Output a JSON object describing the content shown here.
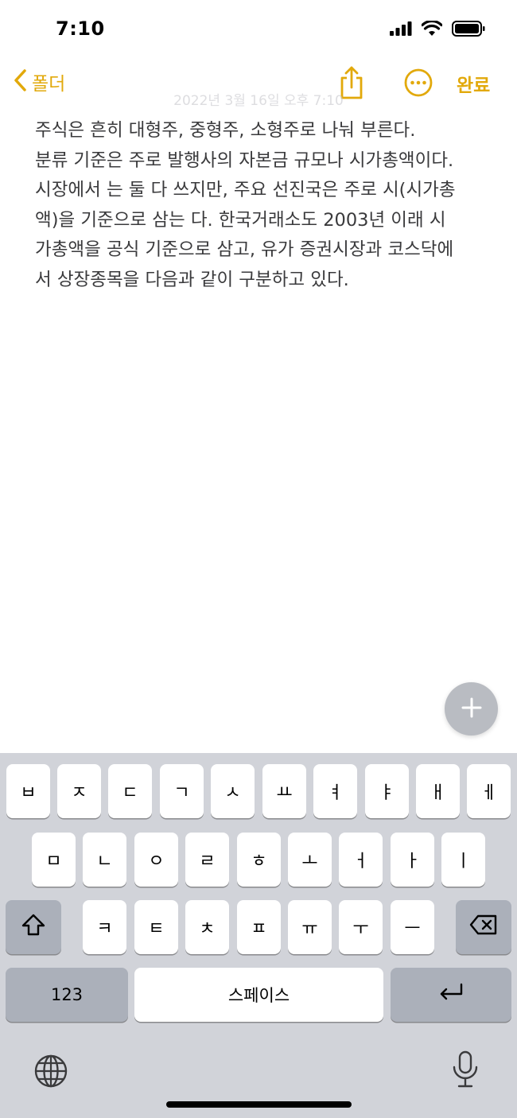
{
  "status_bar": {
    "time": "7:10",
    "icons": [
      "signal-icon",
      "wifi-icon",
      "battery-icon"
    ]
  },
  "nav": {
    "back_label": "폴더",
    "done_label": "완료",
    "share_icon": "share-icon",
    "more_icon": "ellipsis-circle-icon",
    "date_text": "2022년 3월 16일 오후 7:10"
  },
  "note": {
    "lines": [
      "주식은 흔히 대형주, 중형주, 소형주로 나눠 부른다.",
      "분류 기준은 주로 발행사의 자본금 규모나 시가총액이다.",
      "시장에서 는 둘 다 쓰지만, 주요 선진국은 주로 시(시가총",
      "액)을 기준으로 삼는 다. 한국거래소도 2003년 이래 시",
      "가총액을 공식 기준으로 삼고, 유가 증권시장과 코스닥에",
      "서 상장종목을 다음과 같이 구분하고 있다."
    ]
  },
  "fab": {
    "icon": "plus-icon"
  },
  "keyboard": {
    "row1": [
      "ㅂ",
      "ㅈ",
      "ㄷ",
      "ㄱ",
      "ㅅ",
      "ㅛ",
      "ㅕ",
      "ㅑ",
      "ㅐ",
      "ㅔ"
    ],
    "row2": [
      "ㅁ",
      "ㄴ",
      "ㅇ",
      "ㄹ",
      "ㅎ",
      "ㅗ",
      "ㅓ",
      "ㅏ",
      "ㅣ"
    ],
    "row3": [
      "ㅋ",
      "ㅌ",
      "ㅊ",
      "ㅍ",
      "ㅠ",
      "ㅜ",
      "ㅡ"
    ],
    "numbers_label": "123",
    "space_label": "스페이스",
    "shift_icon": "shift-icon",
    "delete_icon": "delete-icon",
    "return_icon": "return-icon",
    "globe_icon": "globe-icon",
    "mic_icon": "microphone-icon"
  },
  "colors": {
    "accent": "#e2a90b",
    "keyboard_bg": "#d1d3d9",
    "key_bg": "#ffffff",
    "key_dark_bg": "#abb0ba"
  }
}
